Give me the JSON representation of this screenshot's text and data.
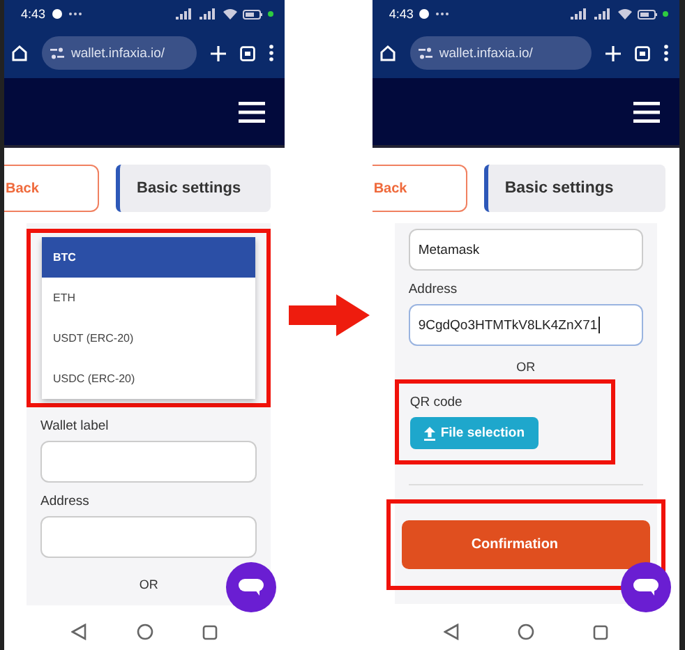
{
  "screens": [
    {
      "status_bar": {
        "time": "4:43"
      },
      "url": "wallet.infaxia.io/",
      "tabs": [
        {
          "label": "Back",
          "kind": "back"
        },
        {
          "label": "Basic settings",
          "kind": "current"
        }
      ],
      "blocks": [
        {
          "kind": "dropdown",
          "highlighted": true,
          "options": [
            {
              "label": "BTC",
              "selected": true
            },
            {
              "label": "ETH",
              "selected": false
            },
            {
              "label": "USDT (ERC-20)",
              "selected": false
            },
            {
              "label": "USDC (ERC-20)",
              "selected": false
            }
          ]
        },
        {
          "kind": "label",
          "text": "Wallet label"
        },
        {
          "kind": "input"
        },
        {
          "kind": "label",
          "text": "Address"
        },
        {
          "kind": "input"
        },
        {
          "kind": "or",
          "text": "OR"
        }
      ]
    },
    {
      "status_bar": {
        "time": "4:43"
      },
      "url": "wallet.infaxia.io/",
      "tabs": [
        {
          "label": "Back",
          "kind": "back"
        },
        {
          "label": "Basic settings",
          "kind": "current"
        }
      ],
      "blocks": [
        {
          "kind": "input",
          "value": "Metamask"
        },
        {
          "kind": "label",
          "text": "Address"
        },
        {
          "kind": "input",
          "value": "9CgdQo3HTMTkV8LK4ZnX71",
          "focused": true
        },
        {
          "kind": "or",
          "text": "OR"
        },
        {
          "kind": "file",
          "highlighted": true,
          "label": "QR code",
          "button": "File selection"
        },
        {
          "kind": "divider"
        },
        {
          "kind": "submit",
          "highlighted": true,
          "text": "Confirmation"
        }
      ]
    }
  ]
}
